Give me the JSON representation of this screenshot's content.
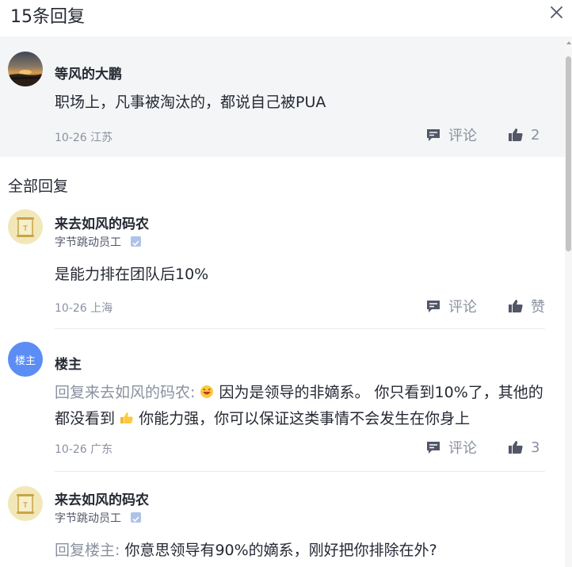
{
  "header": {
    "title": "15条回复"
  },
  "parent_comment": {
    "username": "等风的大鹏",
    "content": "职场上，凡事被淘汰的，都说自己被PUA",
    "date_location": "10-26 江苏",
    "comment_label": "评论",
    "like_count": "2"
  },
  "section_title": "全部回复",
  "replies": [
    {
      "username": "来去如风的码农",
      "job": "字节跳动员工",
      "content": "是能力排在团队后10%",
      "date_location": "10-26 上海",
      "comment_label": "评论",
      "like_label": "赞"
    },
    {
      "avatar_text": "楼主",
      "username": "楼主",
      "reply_prefix": "回复来去如风的码农:",
      "content_part1": "因为是领导的非嫡系。 你只看到10%了，其他的都没看到",
      "content_part2": "你能力强，你可以保证这类事情不会发生在你身上",
      "date_location": "10-26 广东",
      "comment_label": "评论",
      "like_count": "3"
    },
    {
      "username": "来去如风的码农",
      "job": "字节跳动员工",
      "reply_prefix": "回复楼主:",
      "content": "你意思领导有90%的嫡系，刚好把你排除在外?"
    }
  ],
  "colors": {
    "parent_bg": "#f4f5f7",
    "meta_text": "#8a919f",
    "verify_badge": "#aec3e8",
    "louzhu_avatar": "#5c8df5"
  },
  "icons": [
    "close-icon",
    "comment-icon",
    "thumbs-up-icon",
    "verified-icon",
    "grin-emoji-icon",
    "thumbs-up-emoji-icon"
  ]
}
